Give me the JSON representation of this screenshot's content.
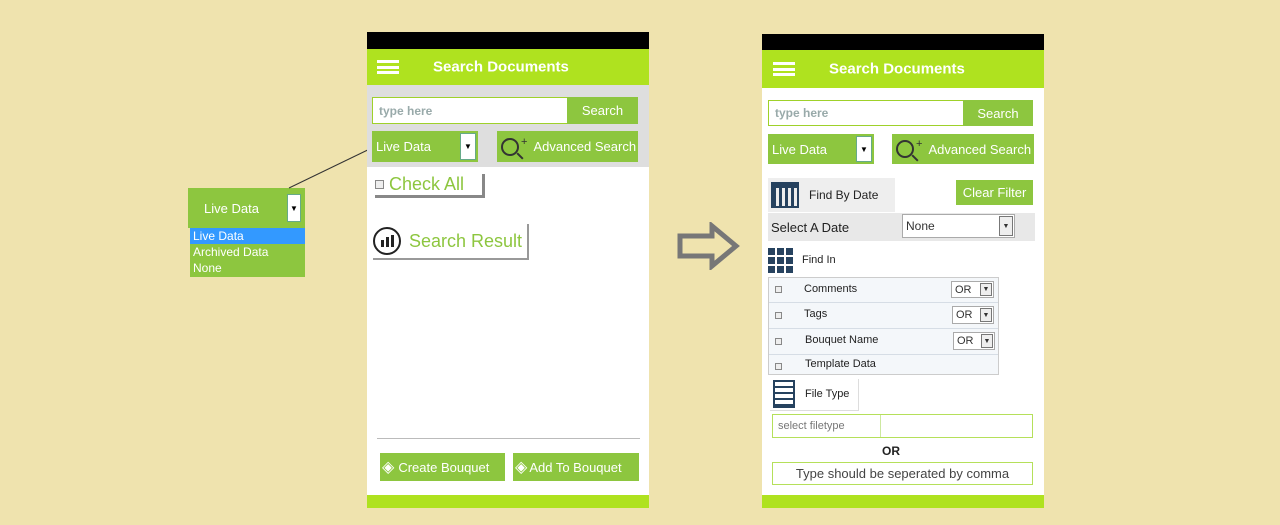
{
  "dropdown_callout": {
    "selected": "Live Data",
    "options": [
      "Live Data",
      "Archived Data",
      "None"
    ]
  },
  "screen1": {
    "title": "Search Documents",
    "search_placeholder": "type here",
    "search_button": "Search",
    "data_select": "Live Data",
    "advanced_search": "Advanced Search",
    "check_all": "Check All",
    "search_result": "Search Result",
    "create_bouquet": "Create Bouquet",
    "add_to_bouquet": "Add To Bouquet"
  },
  "screen2": {
    "title": "Search Documents",
    "search_placeholder": "type here",
    "search_button": "Search",
    "data_select": "Live Data",
    "advanced_search": "Advanced Search",
    "find_by_date": "Find By Date",
    "clear_filter": "Clear Filter",
    "select_a_date": "Select A Date",
    "date_value": "None",
    "find_in": "Find In",
    "find_in_rows": [
      {
        "label": "Comments",
        "op": "OR"
      },
      {
        "label": "Tags",
        "op": "OR"
      },
      {
        "label": "Bouquet Name",
        "op": "OR"
      },
      {
        "label": "Template Data",
        "op": ""
      }
    ],
    "file_type": "File Type",
    "filetype_placeholder": "select filetype",
    "or_label": "OR",
    "type_hint": "Type should be seperated by comma"
  },
  "colors": {
    "accent": "#afe21f",
    "button": "#8dc63f",
    "background": "#efe3ae"
  }
}
